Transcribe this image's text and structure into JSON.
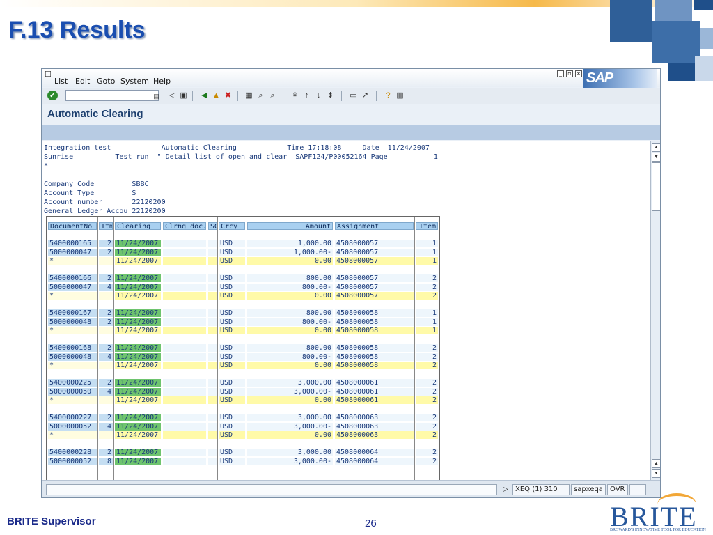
{
  "slide": {
    "title": "F.13 Results",
    "footer_left": "BRITE Supervisor",
    "page_number": "26",
    "logo_text": "BRITE",
    "logo_tagline": "BROWARD'S INNOVATIVE TOOL FOR EDUCATION"
  },
  "sap": {
    "menu": [
      "List",
      "Edit",
      "Goto",
      "System",
      "Help"
    ],
    "logo": "SAP",
    "page_title": "Automatic Clearing",
    "header_lines": [
      "Integration test            Automatic Clearing            Time 17:18:08     Date  11/24/2007",
      "Sunrise          Test run  \" Detail list of open and clear  SAPF124/P00052164 Page           1",
      "*",
      "",
      "Company Code         SBBC",
      "Account Type         S",
      "Account number       22120200",
      "General Ledger Accou 22120200"
    ],
    "columns": [
      "DocumentNo",
      "Itm",
      "Clearing",
      "Clrng doc.",
      "SG",
      "Crcy",
      "Amount",
      "Assignment",
      "Item"
    ],
    "groups": [
      [
        [
          "5400000165",
          "2",
          "11/24/2007",
          "",
          "",
          "USD",
          "1,000.00",
          "4508000057",
          "1"
        ],
        [
          "5000000047",
          "2",
          "11/24/2007",
          "",
          "",
          "USD",
          "1,000.00-",
          "4508000057",
          "1"
        ],
        [
          "*",
          "",
          "11/24/2007",
          "",
          "",
          "USD",
          "0.00",
          "4508000057",
          "1"
        ]
      ],
      [
        [
          "5400000166",
          "2",
          "11/24/2007",
          "",
          "",
          "USD",
          "800.00",
          "4508000057",
          "2"
        ],
        [
          "5000000047",
          "4",
          "11/24/2007",
          "",
          "",
          "USD",
          "800.00-",
          "4508000057",
          "2"
        ],
        [
          "*",
          "",
          "11/24/2007",
          "",
          "",
          "USD",
          "0.00",
          "4508000057",
          "2"
        ]
      ],
      [
        [
          "5400000167",
          "2",
          "11/24/2007",
          "",
          "",
          "USD",
          "800.00",
          "4508000058",
          "1"
        ],
        [
          "5000000048",
          "2",
          "11/24/2007",
          "",
          "",
          "USD",
          "800.00-",
          "4508000058",
          "1"
        ],
        [
          "*",
          "",
          "11/24/2007",
          "",
          "",
          "USD",
          "0.00",
          "4508000058",
          "1"
        ]
      ],
      [
        [
          "5400000168",
          "2",
          "11/24/2007",
          "",
          "",
          "USD",
          "800.00",
          "4508000058",
          "2"
        ],
        [
          "5000000048",
          "4",
          "11/24/2007",
          "",
          "",
          "USD",
          "800.00-",
          "4508000058",
          "2"
        ],
        [
          "*",
          "",
          "11/24/2007",
          "",
          "",
          "USD",
          "0.00",
          "4508000058",
          "2"
        ]
      ],
      [
        [
          "5400000225",
          "2",
          "11/24/2007",
          "",
          "",
          "USD",
          "3,000.00",
          "4508000061",
          "2"
        ],
        [
          "5000000050",
          "4",
          "11/24/2007",
          "",
          "",
          "USD",
          "3,000.00-",
          "4508000061",
          "2"
        ],
        [
          "*",
          "",
          "11/24/2007",
          "",
          "",
          "USD",
          "0.00",
          "4508000061",
          "2"
        ]
      ],
      [
        [
          "5400000227",
          "2",
          "11/24/2007",
          "",
          "",
          "USD",
          "3,000.00",
          "4508000063",
          "2"
        ],
        [
          "5000000052",
          "4",
          "11/24/2007",
          "",
          "",
          "USD",
          "3,000.00-",
          "4508000063",
          "2"
        ],
        [
          "*",
          "",
          "11/24/2007",
          "",
          "",
          "USD",
          "0.00",
          "4508000063",
          "2"
        ]
      ],
      [
        [
          "5400000228",
          "2",
          "11/24/2007",
          "",
          "",
          "USD",
          "3,000.00",
          "4508000064",
          "2"
        ],
        [
          "5000000052",
          "8",
          "11/24/2007",
          "",
          "",
          "USD",
          "3,000.00-",
          "4508000064",
          "2"
        ]
      ]
    ],
    "status": {
      "system": "XEQ (1) 310",
      "server": "sapxeqa",
      "mode": "OVR"
    }
  },
  "colors": {
    "header_cell": "#a9d0f0",
    "clearing_green": "#6ec46e",
    "total_yellow": "#fffaa8",
    "key_blue": "#c5def2"
  }
}
